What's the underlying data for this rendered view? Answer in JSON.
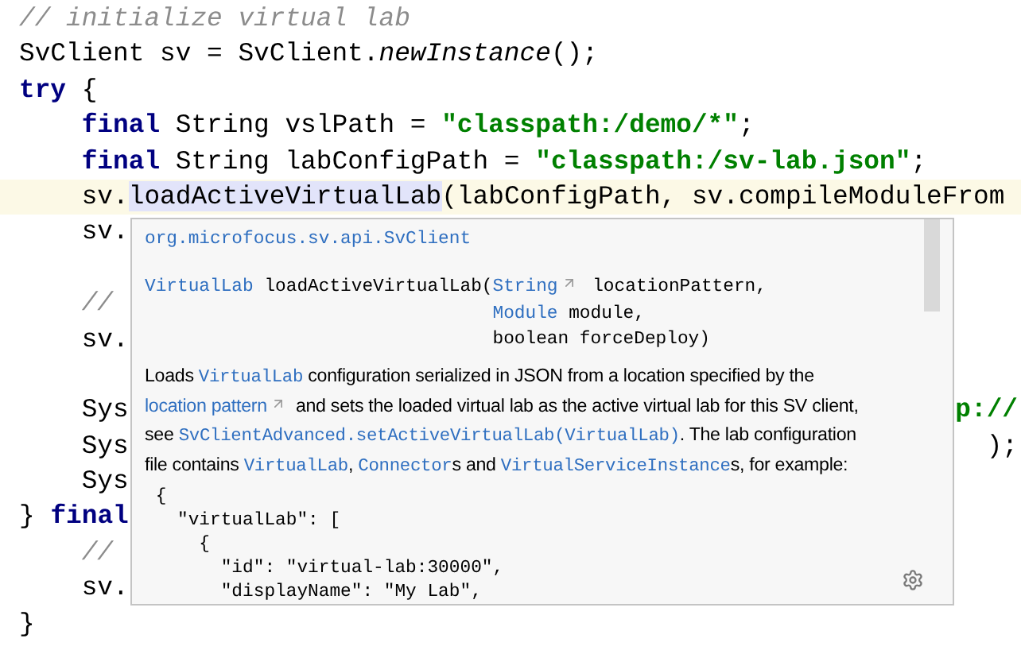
{
  "editor": {
    "lines": [
      {
        "current": false,
        "tokens": [
          {
            "text": "// initialize virtual lab",
            "kind": "comment"
          }
        ]
      },
      {
        "current": false,
        "tokens": [
          {
            "text": "SvClient sv = SvClient.",
            "kind": "plain"
          },
          {
            "text": "newInstance",
            "kind": "italic"
          },
          {
            "text": "();",
            "kind": "plain"
          }
        ]
      },
      {
        "current": false,
        "tokens": [
          {
            "text": "try",
            "kind": "keyword"
          },
          {
            "text": " {",
            "kind": "plain"
          }
        ]
      },
      {
        "current": false,
        "tokens": [
          {
            "text": "    final",
            "kind": "keyword"
          },
          {
            "text": " String vslPath = ",
            "kind": "plain"
          },
          {
            "text": "\"classpath:/demo/*\"",
            "kind": "string"
          },
          {
            "text": ";",
            "kind": "plain"
          }
        ]
      },
      {
        "current": false,
        "tokens": [
          {
            "text": "    final",
            "kind": "keyword"
          },
          {
            "text": " String labConfigPath = ",
            "kind": "plain"
          },
          {
            "text": "\"classpath:/sv-lab.json\"",
            "kind": "string"
          },
          {
            "text": ";",
            "kind": "plain"
          }
        ]
      },
      {
        "current": true,
        "tokens": [
          {
            "text": "    sv.",
            "kind": "plain"
          },
          {
            "text": "loadActiveVirtualLab",
            "kind": "highlight"
          },
          {
            "text": "(labConfigPath, sv.compileModuleFrom",
            "kind": "plain"
          }
        ]
      },
      {
        "current": false,
        "tokens": [
          {
            "text": "    sv.",
            "kind": "plain"
          }
        ]
      },
      {
        "current": false
      },
      {
        "current": false,
        "tokens": [
          {
            "text": "    //",
            "kind": "comment"
          }
        ]
      },
      {
        "current": false,
        "tokens": [
          {
            "text": "    sv.",
            "kind": "plain"
          }
        ]
      },
      {
        "current": false
      },
      {
        "current": false,
        "tokens": [
          {
            "text": "    Sys",
            "kind": "plain"
          }
        ],
        "right": [
          {
            "text": "p://",
            "kind": "string"
          }
        ]
      },
      {
        "current": false,
        "tokens": [
          {
            "text": "    Sys",
            "kind": "plain"
          }
        ],
        "right": [
          {
            "text": ");",
            "kind": "plain"
          }
        ]
      },
      {
        "current": false,
        "tokens": [
          {
            "text": "    Sys",
            "kind": "plain"
          }
        ]
      },
      {
        "current": false,
        "tokens": [
          {
            "text": "} ",
            "kind": "plain"
          },
          {
            "text": "final",
            "kind": "keyword"
          }
        ]
      },
      {
        "current": false,
        "tokens": [
          {
            "text": "    //",
            "kind": "comment"
          }
        ]
      },
      {
        "current": false,
        "tokens": [
          {
            "text": "    sv.",
            "kind": "plain"
          }
        ]
      },
      {
        "current": false,
        "tokens": [
          {
            "text": "}",
            "kind": "plain"
          }
        ]
      }
    ]
  },
  "popup": {
    "package": "org.microfocus.sv.api.SvClient",
    "signature": {
      "head": [
        {
          "text": "VirtualLab",
          "kind": "link"
        },
        {
          "text": " loadActiveVirtualLab(",
          "kind": "text"
        }
      ],
      "params": [
        [
          {
            "text": "String",
            "kind": "external_link"
          },
          {
            "text": " locationPattern,",
            "kind": "text"
          }
        ],
        [
          {
            "text": "Module",
            "kind": "link"
          },
          {
            "text": " module,",
            "kind": "text"
          }
        ],
        [
          {
            "text": "boolean forceDeploy)",
            "kind": "text"
          }
        ]
      ]
    },
    "description": [
      [
        {
          "text": "Loads ",
          "kind": "text"
        },
        {
          "text": "VirtualLab",
          "kind": "code_link"
        },
        {
          "text": " configuration serialized in JSON from a location specified by the",
          "kind": "text"
        }
      ],
      [
        {
          "text": "location pattern",
          "kind": "external_link"
        },
        {
          "text": " and sets the loaded virtual lab as the active virtual lab for this SV client,",
          "kind": "text"
        }
      ],
      [
        {
          "text": "see ",
          "kind": "text"
        },
        {
          "text": "SvClientAdvanced.setActiveVirtualLab(VirtualLab)",
          "kind": "code_link"
        },
        {
          "text": ". The lab configuration",
          "kind": "text"
        }
      ],
      [
        {
          "text": "file contains ",
          "kind": "text"
        },
        {
          "text": "VirtualLab",
          "kind": "code_link"
        },
        {
          "text": ", ",
          "kind": "text"
        },
        {
          "text": "Connector",
          "kind": "code_link"
        },
        {
          "text": "s and ",
          "kind": "text"
        },
        {
          "text": "VirtualServiceInstance",
          "kind": "code_link"
        },
        {
          "text": "s, for example:",
          "kind": "text"
        }
      ]
    ],
    "example": [
      " {",
      "   \"virtualLab\": [",
      "     {",
      "       \"id\": \"virtual-lab:30000\",",
      "       \"displayName\": \"My Lab\","
    ]
  }
}
